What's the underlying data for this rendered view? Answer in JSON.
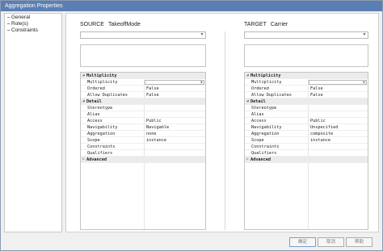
{
  "window": {
    "title": "Aggregation Properties"
  },
  "nav": {
    "items": [
      "General",
      "Role(s)",
      "Constraints"
    ]
  },
  "source": {
    "label": "SOURCE",
    "element": "TakeoffMode",
    "multiplicity_value": "",
    "sections": [
      {
        "title": "Multiplicity",
        "rows": [
          {
            "key": "Multiplicity",
            "value": ""
          },
          {
            "key": "Ordered",
            "value": "False"
          },
          {
            "key": "Allow Duplicates",
            "value": "False"
          }
        ]
      },
      {
        "title": "Detail",
        "rows": [
          {
            "key": "Stereotype",
            "value": ""
          },
          {
            "key": "Alias",
            "value": ""
          },
          {
            "key": "Access",
            "value": "Public"
          },
          {
            "key": "Navigability",
            "value": "Navigable"
          },
          {
            "key": "Aggregation",
            "value": "none"
          },
          {
            "key": "Scope",
            "value": "instance"
          },
          {
            "key": "Constraints",
            "value": ""
          },
          {
            "key": "Qualifiers",
            "value": ""
          }
        ]
      },
      {
        "title": "Advanced",
        "rows": []
      }
    ]
  },
  "target": {
    "label": "TARGET",
    "element": "Carrier",
    "multiplicity_value": "",
    "sections": [
      {
        "title": "Multiplicity",
        "rows": [
          {
            "key": "Multiplicity",
            "value": ""
          },
          {
            "key": "Ordered",
            "value": "False"
          },
          {
            "key": "Allow Duplicates",
            "value": "False"
          }
        ]
      },
      {
        "title": "Detail",
        "rows": [
          {
            "key": "Stereotype",
            "value": ""
          },
          {
            "key": "Alias",
            "value": ""
          },
          {
            "key": "Access",
            "value": "Public"
          },
          {
            "key": "Navigability",
            "value": "Unspecified"
          },
          {
            "key": "Aggregation",
            "value": "composite"
          },
          {
            "key": "Scope",
            "value": "instance"
          },
          {
            "key": "Constraints",
            "value": ""
          },
          {
            "key": "Qualifiers",
            "value": ""
          }
        ]
      },
      {
        "title": "Advanced",
        "rows": []
      }
    ]
  },
  "buttons": {
    "ok": "确定",
    "cancel": "取消",
    "help": "帮助"
  },
  "icons": {
    "collapse": "collapse-triangle-icon",
    "dropdown": "chevron-down-icon"
  }
}
